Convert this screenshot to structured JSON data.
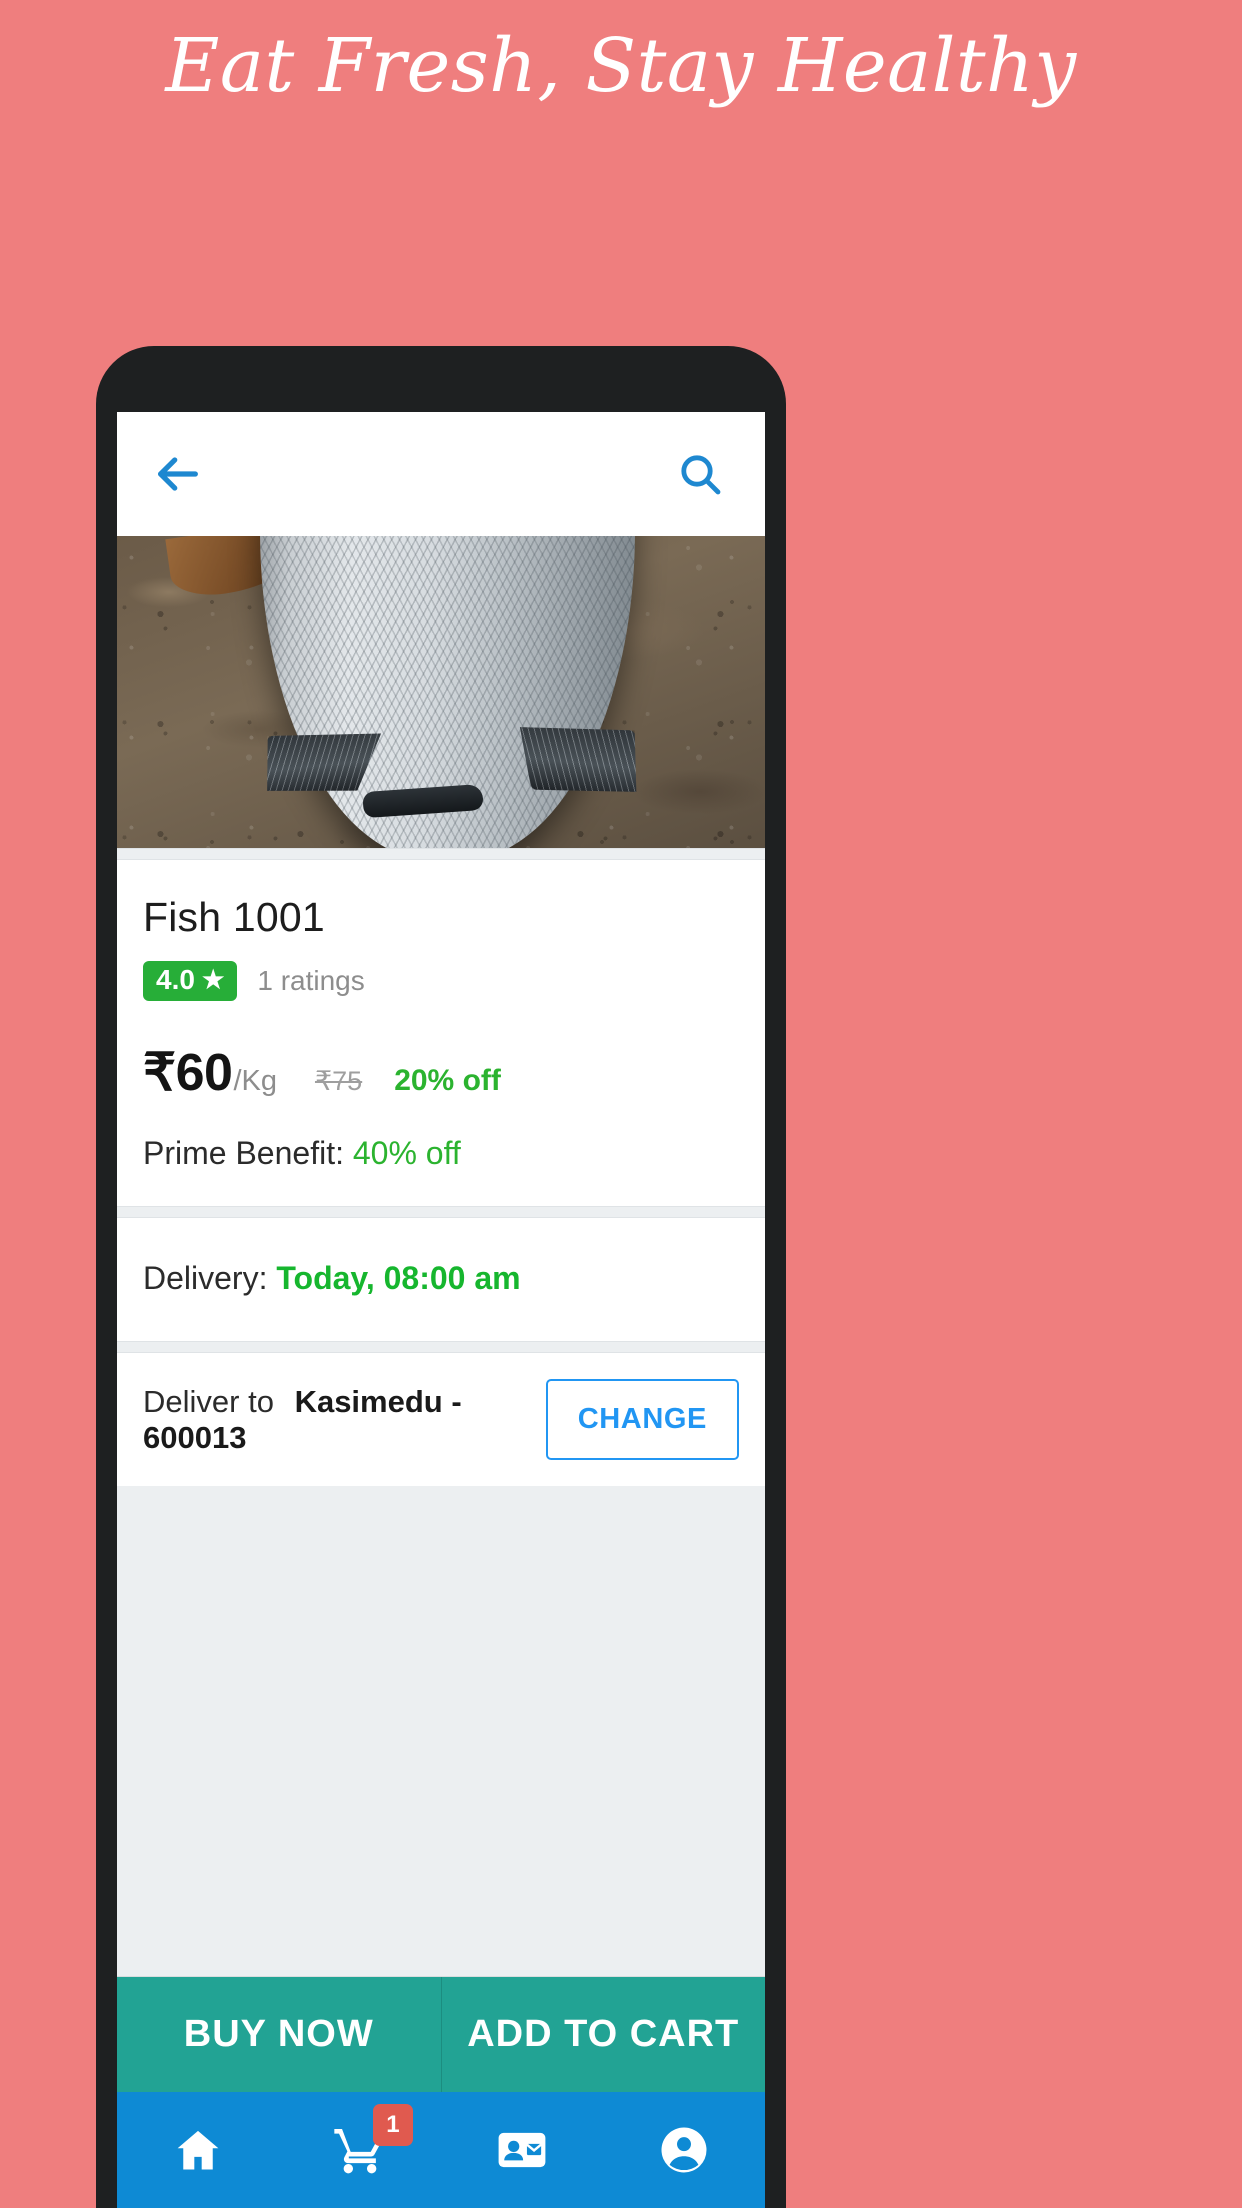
{
  "promo": {
    "headline": "Eat Fresh, Stay Healthy",
    "background_color": "#ef7e7e",
    "text_color": "#ffffff"
  },
  "app_bar": {
    "back_icon": "arrow-left-icon",
    "search_icon": "search-icon",
    "icon_color": "#1e88d0"
  },
  "product": {
    "image_alt": "fish-product-photo",
    "title": "Fish 1001",
    "rating_value": "4.0",
    "rating_star": "★",
    "rating_count": "1 ratings",
    "rating_badge_color": "#27ae38",
    "price_current": "₹60",
    "price_unit": "/Kg",
    "price_mrp": "₹75",
    "price_discount": "20% off",
    "prime_label": "Prime Benefit:",
    "prime_value": "40% off",
    "discount_color": "#2bb32f"
  },
  "delivery": {
    "label": "Delivery:",
    "value": "Today, 08:00 am",
    "value_color": "#16b62e"
  },
  "address": {
    "label": "Deliver to",
    "value": "Kasimedu - 600013",
    "change_label": "CHANGE",
    "change_color": "#2196f3"
  },
  "actions": {
    "buy_now": "BUY NOW",
    "add_to_cart": "ADD TO CART",
    "bar_color": "#22a394"
  },
  "bottom_nav": {
    "bar_color": "#0e8ad4",
    "items": [
      {
        "name": "home",
        "icon": "home-icon"
      },
      {
        "name": "cart",
        "icon": "shopping-cart-icon",
        "badge": "1",
        "badge_color": "#e05a4f"
      },
      {
        "name": "contacts",
        "icon": "contact-card-icon"
      },
      {
        "name": "account",
        "icon": "account-circle-icon"
      }
    ]
  }
}
